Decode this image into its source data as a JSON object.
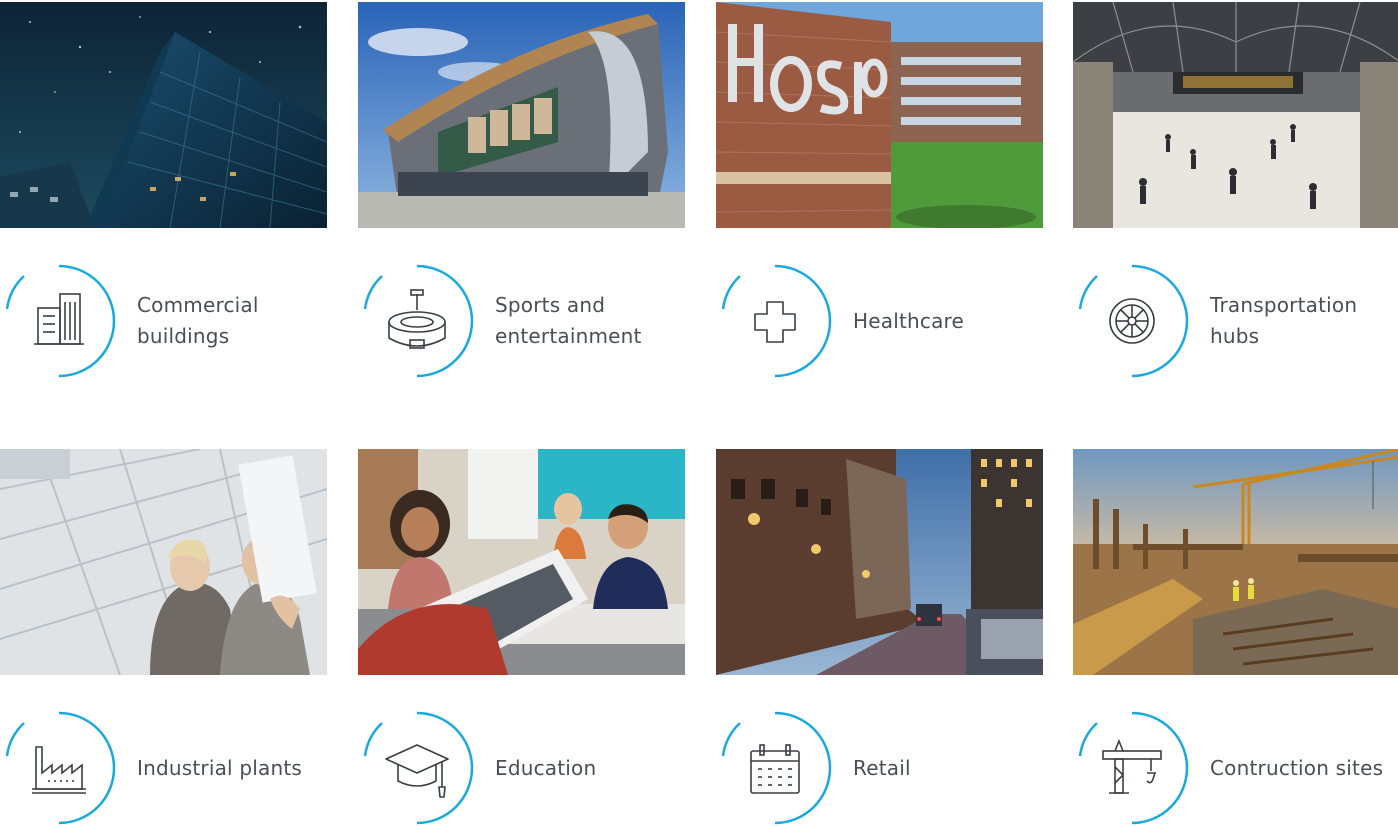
{
  "accent_color": "#1aa9de",
  "tiles": [
    {
      "label": "Commercial\nbuildings",
      "icon": "office-building-icon",
      "photo": "night-glass-tower"
    },
    {
      "label": "Sports and\nentertainment",
      "icon": "stadium-icon",
      "photo": "arena-exterior"
    },
    {
      "label": "Healthcare",
      "icon": "medical-cross-icon",
      "photo": "hospital-sign"
    },
    {
      "label": "Transportation\nhubs",
      "icon": "wheel-icon",
      "photo": "train-station-concourse"
    },
    {
      "label": "Industrial plants",
      "icon": "factory-icon",
      "photo": "office-workers-glass-atrium"
    },
    {
      "label": "Education",
      "icon": "graduation-cap-icon",
      "photo": "classroom-students"
    },
    {
      "label": "Retail",
      "icon": "calendar-icon",
      "photo": "city-street-dusk"
    },
    {
      "label": "Contruction sites",
      "icon": "construction-crane-icon",
      "photo": "construction-site-crane"
    }
  ]
}
